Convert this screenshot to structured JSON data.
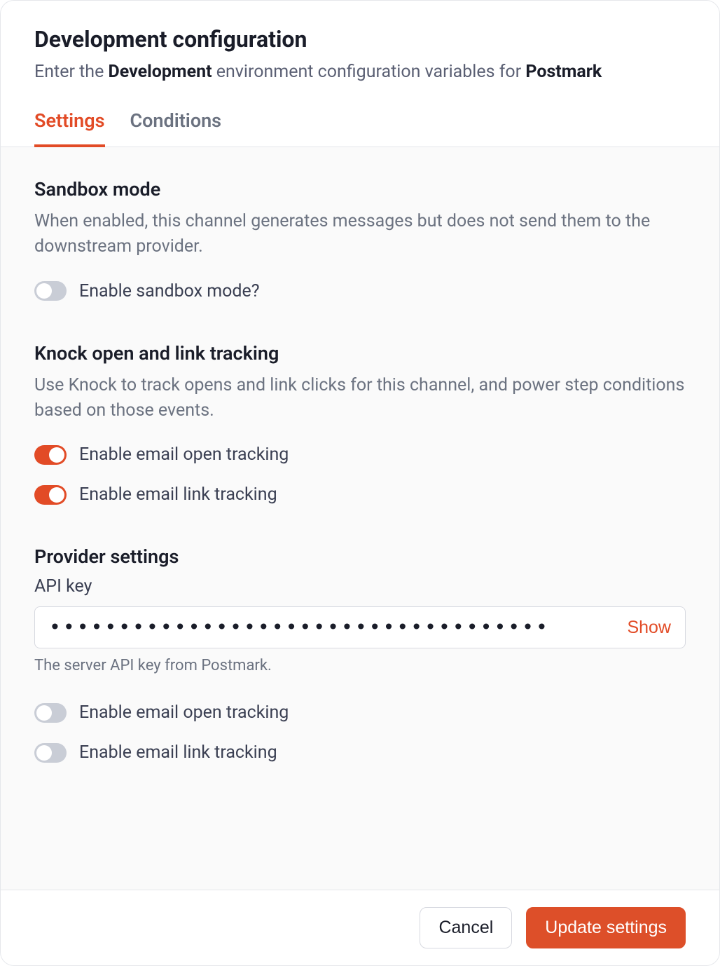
{
  "header": {
    "title": "Development configuration",
    "subtitle_pre": "Enter the ",
    "subtitle_env": "Development",
    "subtitle_mid": " environment configuration variables for ",
    "subtitle_provider": "Postmark"
  },
  "tabs": {
    "settings": "Settings",
    "conditions": "Conditions"
  },
  "sandbox": {
    "title": "Sandbox mode",
    "desc": "When enabled, this channel generates messages but does not send them to the downstream provider.",
    "toggle_label": "Enable sandbox mode?",
    "enabled": false
  },
  "tracking": {
    "title": "Knock open and link tracking",
    "desc": "Use Knock to track opens and link clicks for this channel, and power step conditions based on those events.",
    "open_label": "Enable email open tracking",
    "open_enabled": true,
    "link_label": "Enable email link tracking",
    "link_enabled": true
  },
  "provider": {
    "title": "Provider settings",
    "api_key_label": "API key",
    "api_key_masked": "••••••••••••••••••••••••••••••••••••",
    "show_label": "Show",
    "api_key_help": "The server API key from Postmark.",
    "open_label": "Enable email open tracking",
    "open_enabled": false,
    "link_label": "Enable email link tracking",
    "link_enabled": false
  },
  "footer": {
    "cancel": "Cancel",
    "update": "Update settings"
  }
}
